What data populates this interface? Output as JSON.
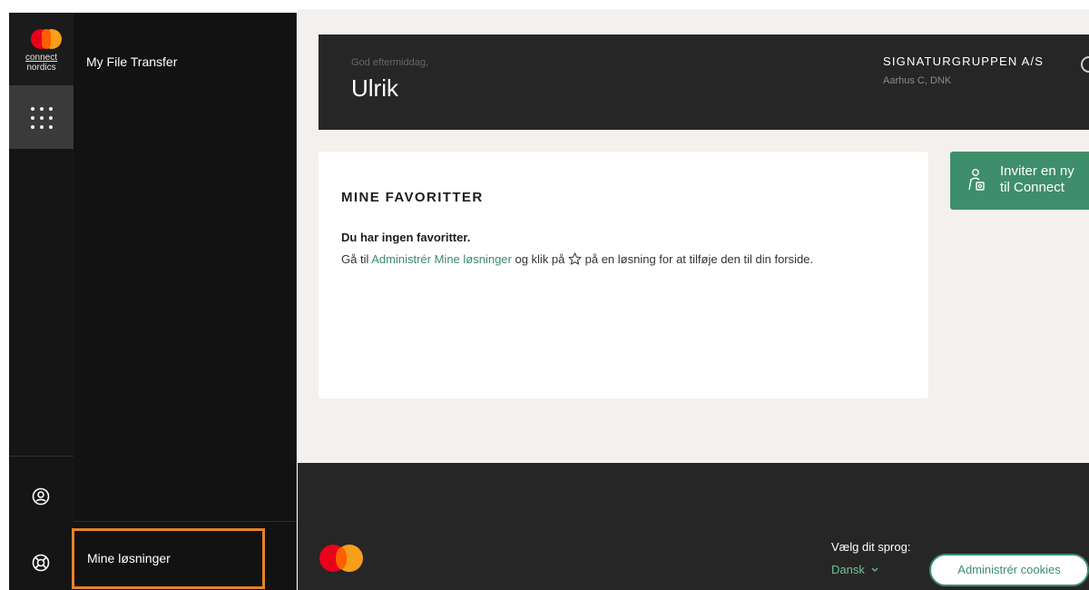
{
  "brand": {
    "logo_line1": "connect",
    "logo_line2": "nordics",
    "colors": {
      "red": "#eb001b",
      "orange": "#f79e1b",
      "accent_green": "#3e8e6b"
    }
  },
  "rail": {
    "apps_icon": "grid-dots-icon",
    "profile_icon": "user-circle-icon",
    "help_icon": "lifebuoy-icon"
  },
  "panel": {
    "items": [
      {
        "label": "My File Transfer"
      }
    ],
    "bottom_item": {
      "label": "Mine løsninger",
      "highlight_color": "#e8822a"
    }
  },
  "greeting": {
    "subtitle": "God eftermiddag,",
    "name": "Ulrik",
    "org_name": "SIGNATURGRUPPEN A/S",
    "org_location": "Aarhus C, DNK"
  },
  "favorites": {
    "title": "MINE FAVORITTER",
    "empty_text": "Du har ingen favoritter.",
    "help_prefix": "Gå til ",
    "help_link": "Administrér Mine løsninger",
    "help_middle": " og klik på ",
    "help_suffix": " på en løsning for at tilføje den til din forside.",
    "star_icon": "star-outline-icon"
  },
  "invite": {
    "line1": "Inviter en ny",
    "line2": "til Connect",
    "icon": "invite-user-icon"
  },
  "footer": {
    "language_label": "Vælg dit sprog:",
    "language_value": "Dansk",
    "cookies_button": "Administrér cookies"
  }
}
